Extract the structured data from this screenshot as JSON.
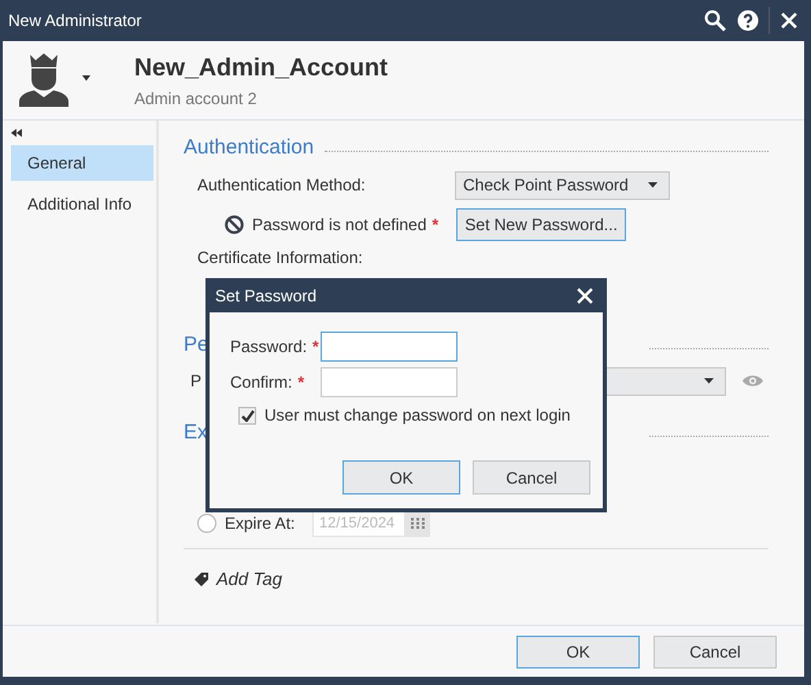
{
  "window": {
    "title": "New Administrator"
  },
  "header": {
    "name": "New_Admin_Account",
    "comment": "Admin account 2"
  },
  "sidebar": {
    "items": [
      {
        "label": "General",
        "selected": true
      },
      {
        "label": "Additional Info",
        "selected": false
      }
    ]
  },
  "authentication": {
    "heading": "Authentication",
    "method_label": "Authentication Method:",
    "method_value": "Check Point Password",
    "password_status": "Password is not defined",
    "required_mark": "*",
    "set_password_button": "Set New Password...",
    "certificate_label": "Certificate Information:"
  },
  "permissions": {
    "heading": "Pe",
    "label": "P"
  },
  "expiration": {
    "heading": "Ex",
    "expire_label": "Expire At:",
    "expire_selected": false,
    "date": "12/15/2024"
  },
  "add_tag": "Add Tag",
  "buttons": [
    {
      "label": "OK",
      "default": true
    },
    {
      "label": "Cancel",
      "default": false
    }
  ],
  "dialog": {
    "title": "Set Password",
    "fields": [
      {
        "label": "Password:",
        "required_mark": "*",
        "focused": true
      },
      {
        "label": "Confirm:",
        "required_mark": "*",
        "focused": false
      }
    ],
    "change_on_login": {
      "label": "User must change password on next login",
      "checked": true
    },
    "buttons": [
      {
        "label": "OK",
        "default": true
      },
      {
        "label": "Cancel",
        "default": false
      }
    ]
  }
}
